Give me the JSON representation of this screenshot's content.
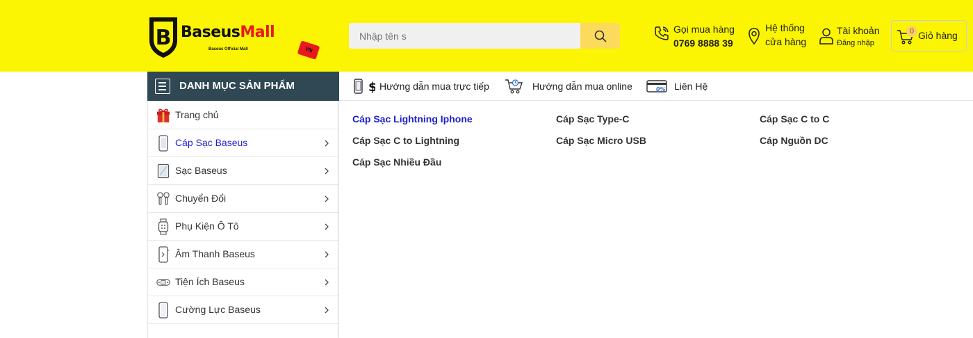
{
  "brand": {
    "name_main": "Baseus",
    "name_accent": "Mall",
    "tagline": "Baseus Official Mall",
    "tag": "VN"
  },
  "search": {
    "placeholder": "Nhập tên s",
    "value": ""
  },
  "header": {
    "phone_label": "Gọi mua hàng",
    "phone_number": "0769 8888 39",
    "store_line1": "Hệ thống",
    "store_line2": "cửa hàng",
    "account_label": "Tài khoản",
    "account_sub": "Đăng nhập",
    "cart_count": "0",
    "cart_label": "Giỏ hàng"
  },
  "category_header": "DANH MỤC SẢN PHẨM",
  "nav": {
    "items": [
      {
        "label": "Hướng dẫn mua trực tiếp",
        "icon": "phone-dollar-icon"
      },
      {
        "label": "Hướng dẫn mua online",
        "icon": "shopping-cart-icon"
      },
      {
        "label": "Liên Hệ",
        "icon": "credit-card-icon"
      }
    ]
  },
  "sidebar": {
    "items": [
      {
        "label": "Trang chủ",
        "icon": "gift-icon",
        "has_arrow": false,
        "active": false
      },
      {
        "label": "Cáp Sạc Baseus",
        "icon": "phone-icon",
        "has_arrow": true,
        "active": true
      },
      {
        "label": "Sạc Baseus",
        "icon": "tablet-icon",
        "has_arrow": true,
        "active": false
      },
      {
        "label": "Chuyển Đổi",
        "icon": "earbuds-icon",
        "has_arrow": true,
        "active": false
      },
      {
        "label": "Phụ Kiện Ô Tô",
        "icon": "smartwatch-icon",
        "has_arrow": true,
        "active": false
      },
      {
        "label": "Âm Thanh Baseus",
        "icon": "phone-speaker-icon",
        "has_arrow": true,
        "active": false
      },
      {
        "label": "Tiện Ích Baseus",
        "icon": "gamepad-icon",
        "has_arrow": true,
        "active": false
      },
      {
        "label": "Cường Lực Baseus",
        "icon": "phone-case-icon",
        "has_arrow": true,
        "active": false
      }
    ]
  },
  "submenu": {
    "links": [
      {
        "label": "Cáp Sạc Lightning Iphone",
        "active": true
      },
      {
        "label": "Cáp Sạc Type-C",
        "active": false
      },
      {
        "label": "Cáp Sạc C to C",
        "active": false
      },
      {
        "label": "Cáp Sạc C to Lightning",
        "active": false
      },
      {
        "label": "Cáp Sạc Micro USB",
        "active": false
      },
      {
        "label": "Cáp Nguồn DC",
        "active": false
      },
      {
        "label": "Cáp Sạc Nhiều Đầu",
        "active": false
      }
    ]
  },
  "colors": {
    "header_bg": "#fbf403",
    "category_bg": "#2f4854",
    "active_link": "#1d1fcf",
    "search_button": "#fcdb5c",
    "logo_accent": "#e8191e"
  }
}
